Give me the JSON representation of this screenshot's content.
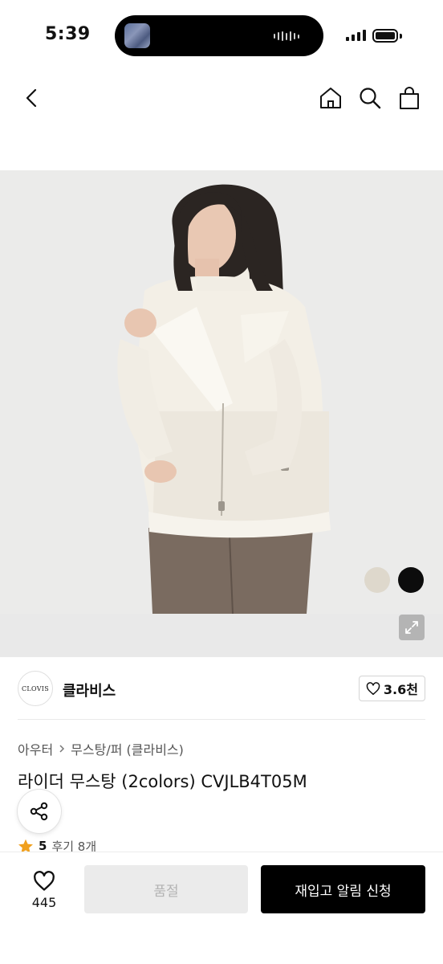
{
  "status_bar": {
    "time": "5:39"
  },
  "nav": {
    "icons": [
      "chevron-left-icon",
      "home-icon",
      "search-icon",
      "bag-icon"
    ]
  },
  "product_image": {
    "swatches": [
      {
        "name": "ivory",
        "color": "#ded8cc"
      },
      {
        "name": "black",
        "color": "#0c0c0c"
      }
    ]
  },
  "brand": {
    "logo_text": "CLOVIS",
    "name": "클라비스",
    "likes": "3.6천"
  },
  "breadcrumb": [
    "아우터",
    "무스탕/퍼 (클라비스)"
  ],
  "product": {
    "title": "라이더 무스탕 (2colors) CVJLB4T05M"
  },
  "rating": {
    "score": "5",
    "review_text": "후기 8개"
  },
  "bottom_bar": {
    "wish_count": "445",
    "soldout_label": "품절",
    "restock_label": "재입고 알림 신청"
  },
  "colors": {
    "accent_star": "#f0a01e",
    "primary_button": "#000000",
    "disabled_button": "#ebebeb"
  }
}
